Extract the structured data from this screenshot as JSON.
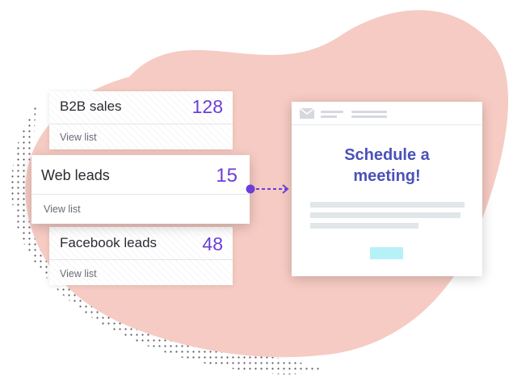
{
  "colors": {
    "blob": "#f6cbc3",
    "accent": "#6a3fd9",
    "title": "#4a52b8",
    "cta": "#b7f1f8"
  },
  "lists": [
    {
      "name": "B2B sales",
      "count": "128",
      "link": "View list"
    },
    {
      "name": "Web leads",
      "count": "15",
      "link": "View list"
    },
    {
      "name": "Facebook leads",
      "count": "48",
      "link": "View list"
    }
  ],
  "email": {
    "icon": "envelope-icon",
    "title_line1": "Schedule a",
    "title_line2": "meeting!"
  }
}
